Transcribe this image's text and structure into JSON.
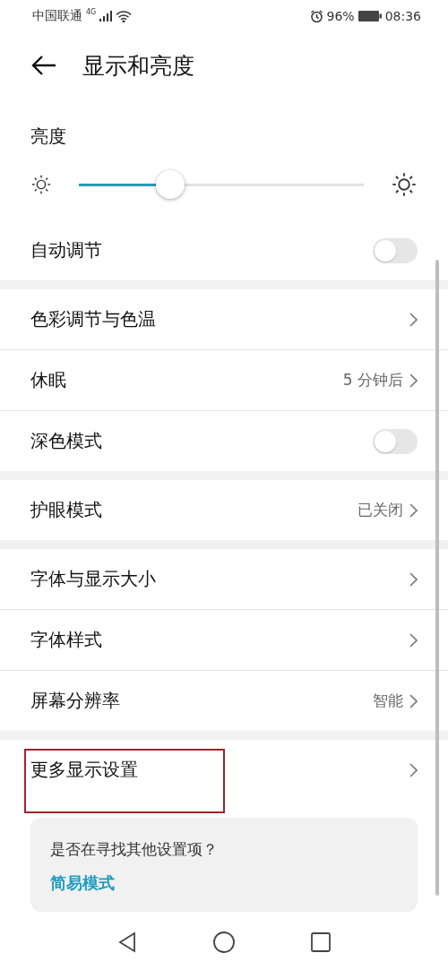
{
  "status_bar": {
    "carrier": "中国联通",
    "network": "4G",
    "battery": "96%",
    "time": "08:36"
  },
  "header": {
    "title": "显示和亮度"
  },
  "brightness": {
    "label": "亮度",
    "level": 0.32,
    "auto_label": "自动调节",
    "auto_on": false
  },
  "groups": [
    {
      "rows": [
        {
          "kind": "chevron",
          "label": "色彩调节与色温",
          "highlighted": false
        },
        {
          "kind": "chevron",
          "label": "休眠",
          "value": "5 分钟后",
          "highlighted": false
        },
        {
          "kind": "toggle",
          "label": "深色模式",
          "on": false,
          "highlighted": false
        }
      ]
    },
    {
      "rows": [
        {
          "kind": "chevron",
          "label": "护眼模式",
          "value": "已关闭",
          "highlighted": false
        }
      ]
    },
    {
      "rows": [
        {
          "kind": "chevron",
          "label": "字体与显示大小",
          "highlighted": false
        },
        {
          "kind": "chevron",
          "label": "字体样式",
          "highlighted": false
        },
        {
          "kind": "chevron",
          "label": "屏幕分辨率",
          "value": "智能",
          "highlighted": false
        }
      ]
    },
    {
      "rows": [
        {
          "kind": "chevron",
          "label": "更多显示设置",
          "highlighted": true
        }
      ]
    }
  ],
  "suggestion": {
    "question": "是否在寻找其他设置项？",
    "link": "简易模式"
  }
}
